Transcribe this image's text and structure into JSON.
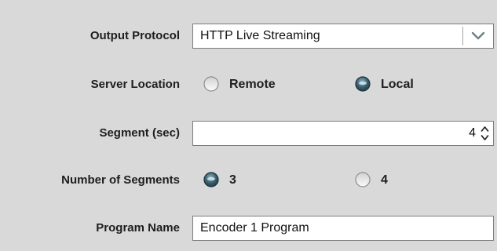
{
  "output_protocol": {
    "label": "Output Protocol",
    "value": "HTTP Live Streaming"
  },
  "server_location": {
    "label": "Server Location",
    "options": [
      "Remote",
      "Local"
    ],
    "selected": "Local"
  },
  "segment": {
    "label": "Segment (sec)",
    "value": "4"
  },
  "number_of_segments": {
    "label": "Number of Segments",
    "options": [
      "3",
      "4"
    ],
    "selected": "3"
  },
  "program_name": {
    "label": "Program Name",
    "value": "Encoder 1 Program"
  },
  "icons": {
    "dropdown": "chevron-down-icon",
    "spinner": "spinner-arrows-icon",
    "radio_selected": "radio-selected-icon",
    "radio_unselected": "radio-unselected-icon"
  },
  "colors": {
    "background": "#d9d9d9",
    "field_border": "#7c7c7c",
    "radio_selected_fill": "#3a5f6e"
  }
}
